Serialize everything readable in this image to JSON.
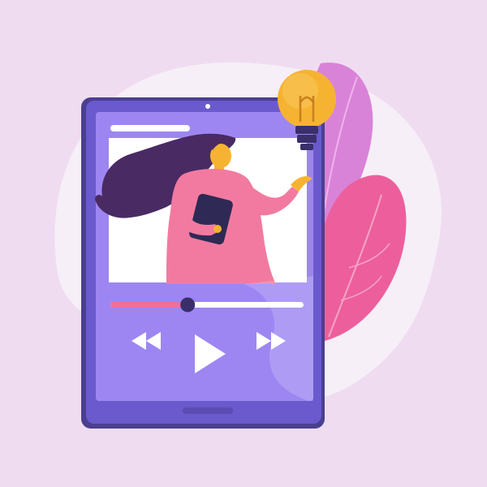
{
  "colors": {
    "background": "#f0dcf1",
    "blob": "#f6eff8",
    "tablet_frame": "#6a5acd",
    "tablet_frame_dark": "#4a3f8f",
    "screen": "#9d86f2",
    "video_area": "#ffffff",
    "leaf_pink": "#ec5f9c",
    "leaf_magenta": "#d983d8",
    "hair": "#4a2a63",
    "dress": "#f27aa0",
    "bulb": "#f6b331",
    "progress_played": "#ef6f9a",
    "progress_track": "#ffffff"
  },
  "player": {
    "progress_fraction": 0.4,
    "controls": [
      "rewind-icon",
      "play-icon",
      "fast-forward-icon"
    ]
  }
}
